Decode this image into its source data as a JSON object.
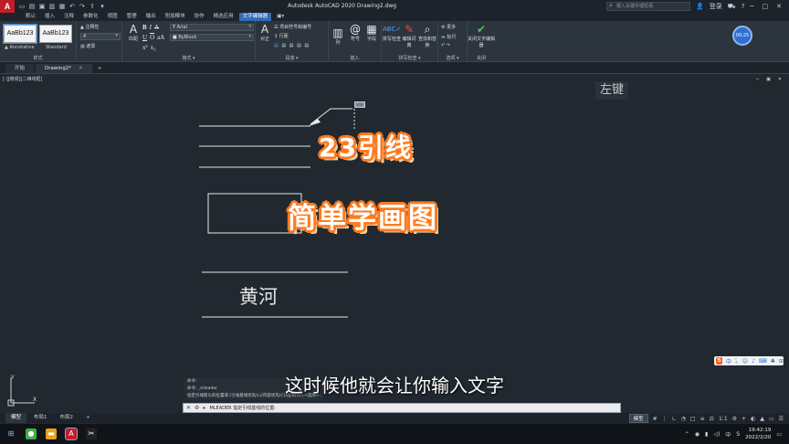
{
  "titlebar": {
    "title": "Autodesk AutoCAD 2020    Drawing2.dwg",
    "search_placeholder": "键入关键字或短语",
    "user_label": "登录",
    "app_logo": "A"
  },
  "menu_tabs": [
    "默认",
    "插入",
    "注释",
    "参数化",
    "视图",
    "管理",
    "输出",
    "附加模块",
    "协作",
    "精选应用",
    "文字编辑器"
  ],
  "active_menu_tab": "文字编辑器",
  "ribbon": {
    "style_samples": [
      {
        "sample": "AaBb123",
        "caption": "Annotative"
      },
      {
        "sample": "AaBb123",
        "caption": "Standard"
      }
    ],
    "style_panel_title": "样式",
    "annotative_label": "注释性",
    "height_value": "4",
    "mask_label": "遮罩",
    "match_label": "匹配",
    "font_value": "Arial",
    "color_value": "ByBlock",
    "format_panel_title": "格式",
    "justify_label": "对正",
    "bullets_label": "项目符号和编号",
    "line_spacing_label": "行距",
    "paragraph_panel_title": "段落",
    "columns_label": "列",
    "symbol_label": "符号",
    "field_label": "字段",
    "insert_panel_title": "插入",
    "spellcheck_label": "拼写检查",
    "edit_dict_label": "编辑词典",
    "find_replace_label": "查找和替换",
    "spell_panel_title": "拼写检查",
    "tools_panel_title": "工具",
    "more_label": "更多",
    "ruler_label": "标尺",
    "options_panel_title": "选项",
    "close_editor_label": "关闭文字编辑器",
    "close_panel_title": "关闭",
    "timer": "00:25"
  },
  "doc_tabs": [
    {
      "label": "开始",
      "active": false
    },
    {
      "label": "Drawing2*",
      "active": true
    }
  ],
  "drawing": {
    "viewport_label": "[-][俯视][二维线框]",
    "left_key_label": "左键",
    "overlay_title_1": "23引线",
    "overlay_title_2": "简单学画图",
    "cad_text": "黄河",
    "leader_tag": "<>",
    "subtitle": "这时候他就会让你输入文字",
    "ucs_y": "Y",
    "ucs_x": "X"
  },
  "command_history": [
    "命令:",
    "命令: _mleader",
    "指定引线箭头的位置或 [引线基线优先(L)/内容优先(C)/选项(O)] <选项>:"
  ],
  "command_line": {
    "text": "MLEADER 指定引线基线的位置:"
  },
  "layout_tabs": [
    {
      "label": "模型",
      "active": true
    },
    {
      "label": "布局1",
      "active": false
    },
    {
      "label": "布局2",
      "active": false
    }
  ],
  "status": {
    "model_label": "模型",
    "scale_label": "1:1"
  },
  "ime": {
    "logo": "S",
    "lang": "中"
  },
  "clock": {
    "time": "19:42:19",
    "date": "2022/2/20"
  },
  "colors": {
    "background": "#212830",
    "accent": "#2f6db5",
    "title_outline": "#ff7a1f"
  }
}
